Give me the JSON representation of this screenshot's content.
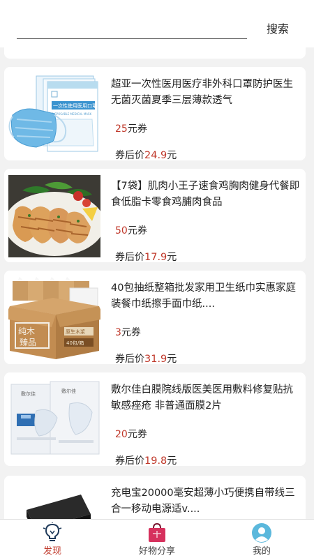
{
  "search": {
    "placeholder": "",
    "button_label": "搜索"
  },
  "products": [
    {
      "title": "超亚一次性医用医疗非外科口罩防护医生无菌灭菌夏季三层薄款透气",
      "coupon_value": "25",
      "coupon_suffix": "元券",
      "after_prefix": "券后价",
      "after_price": "24.9",
      "after_suffix": "元",
      "package_text": "一次性使用医用口罩",
      "package_sub": "DISPOSABLE MEDICAL MASK"
    },
    {
      "title": "【7袋】肌肉小王子速食鸡胸肉健身代餐即食低脂卡零食鸡脯肉食品",
      "coupon_value": "50",
      "coupon_suffix": "元券",
      "after_prefix": "券后价",
      "after_price": "17.9",
      "after_suffix": "元"
    },
    {
      "title": "40包抽纸整箱批发家用卫生纸巾实惠家庭装餐巾纸擦手面巾纸....",
      "coupon_value": "3",
      "coupon_suffix": "元券",
      "after_prefix": "券后价",
      "after_price": "31.9",
      "after_suffix": "元",
      "box_text_1": "纯木",
      "box_text_2": "臻品",
      "box_text_3": "原生木浆",
      "box_text_4": "40包/箱"
    },
    {
      "title": "敷尔佳白膜院线版医美医用敷料修复贴抗敏感痤疮 非普通面膜2片",
      "coupon_value": "20",
      "coupon_suffix": "元券",
      "after_prefix": "券后价",
      "after_price": "19.8",
      "after_suffix": "元",
      "brand_text": "敷尔佳"
    },
    {
      "title": "充电宝20000毫安超薄小巧便携自带线三合一移动电源适v...."
    }
  ],
  "tabs": [
    {
      "label": "发现",
      "icon": "bulb-icon"
    },
    {
      "label": "好物分享",
      "icon": "gift-bag-icon"
    },
    {
      "label": "我的",
      "icon": "user-avatar-icon"
    }
  ],
  "colors": {
    "accent": "#c0392b",
    "background": "#f2f2f2",
    "card": "#ffffff"
  }
}
